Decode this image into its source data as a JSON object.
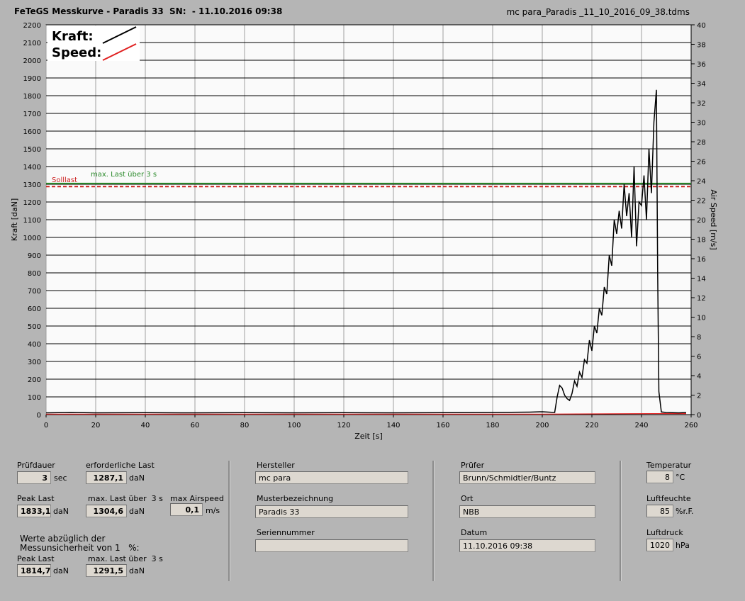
{
  "window": {
    "title": "FeTeGS Messkurve - Paradis 33  SN:  - 11.10.2016 09:38",
    "filename": "mc para_Paradis _11_10_2016_09_38.tdms"
  },
  "chart_data": {
    "type": "line",
    "xlabel": "Zeit [s]",
    "ylabel": "Kraft [daN]",
    "y2label": "Air Speed [m/s]",
    "xlim": [
      0,
      260
    ],
    "ylim": [
      0,
      2200
    ],
    "y2lim": [
      0,
      40
    ],
    "xticks": [
      0,
      20,
      40,
      60,
      80,
      100,
      120,
      140,
      160,
      180,
      200,
      220,
      240,
      260
    ],
    "yticks": [
      0,
      100,
      200,
      300,
      400,
      500,
      600,
      700,
      800,
      900,
      1000,
      1100,
      1200,
      1300,
      1400,
      1500,
      1600,
      1700,
      1800,
      1900,
      2000,
      2100,
      2200
    ],
    "y2ticks": [
      0,
      2,
      4,
      6,
      8,
      10,
      12,
      14,
      16,
      18,
      20,
      22,
      24,
      26,
      28,
      30,
      32,
      34,
      36,
      38,
      40
    ],
    "legend": [
      {
        "name": "Kraft:",
        "color": "#000000"
      },
      {
        "name": "Speed:",
        "color": "#e02020"
      }
    ],
    "reference_lines": [
      {
        "label": "Solllast",
        "value": 1287.1,
        "color": "#cc2020",
        "style": "dashed"
      },
      {
        "label": "max. Last über  3 s",
        "value": 1304.6,
        "color": "#2a8a2a",
        "style": "solid"
      }
    ],
    "series": [
      {
        "name": "Kraft",
        "color": "#000000",
        "x": [
          0,
          10,
          20,
          40,
          60,
          80,
          100,
          120,
          140,
          160,
          180,
          195,
          200,
          205,
          206,
          207,
          208,
          209,
          210,
          211,
          212,
          213,
          214,
          215,
          216,
          217,
          218,
          219,
          220,
          221,
          222,
          223,
          224,
          225,
          226,
          227,
          228,
          229,
          230,
          231,
          232,
          233,
          234,
          235,
          236,
          237,
          238,
          239,
          240,
          241,
          242,
          243,
          244,
          245,
          246,
          246.5,
          247,
          248,
          250,
          255,
          258
        ],
        "y": [
          10,
          12,
          10,
          11,
          10,
          11,
          10,
          11,
          10,
          11,
          12,
          14,
          16,
          12,
          100,
          165,
          150,
          110,
          90,
          80,
          120,
          190,
          160,
          240,
          210,
          310,
          290,
          420,
          360,
          500,
          460,
          600,
          560,
          720,
          680,
          900,
          840,
          1100,
          1020,
          1150,
          1050,
          1300,
          1120,
          1250,
          1000,
          1400,
          950,
          1200,
          1180,
          1350,
          1100,
          1500,
          1250,
          1650,
          1833,
          800,
          130,
          15,
          12,
          10,
          12
        ]
      },
      {
        "name": "Speed",
        "color": "#e02020",
        "x": [
          0,
          200,
          245,
          258
        ],
        "y": [
          0.05,
          0.05,
          0.1,
          0.1
        ]
      }
    ]
  },
  "fields": {
    "pruefdauer": {
      "label": "Prüfdauer",
      "value": "3",
      "unit": "sec"
    },
    "erforderliche_last": {
      "label": "erforderliche Last",
      "value": "1287,1",
      "unit": "daN"
    },
    "peak_last": {
      "label": "Peak Last",
      "value": "1833,1",
      "unit": "daN"
    },
    "max_last": {
      "label": "max. Last über  3 s",
      "value": "1304,6",
      "unit": "daN"
    },
    "max_airspeed": {
      "label": "max Airspeed",
      "value": "0,1",
      "unit": "m/s"
    },
    "note": "Werte abzüglich der\nMessunsicherheit von 1   %:",
    "peak_last2": {
      "label": "Peak Last",
      "value": "1814,7",
      "unit": "daN"
    },
    "max_last2": {
      "label": "max. Last über  3 s",
      "value": "1291,5",
      "unit": "daN"
    },
    "hersteller": {
      "label": "Hersteller",
      "value": "mc para"
    },
    "musterbezeichnung": {
      "label": "Musterbezeichnung",
      "value": "Paradis 33"
    },
    "seriennummer": {
      "label": "Seriennummer",
      "value": ""
    },
    "pruefer": {
      "label": "Prüfer",
      "value": "Brunn/Schmidtler/Buntz"
    },
    "ort": {
      "label": "Ort",
      "value": "NBB"
    },
    "datum": {
      "label": "Datum",
      "value": "11.10.2016 09:38"
    },
    "temperatur": {
      "label": "Temperatur",
      "value": "8",
      "unit": "°C"
    },
    "luftfeuchte": {
      "label": "Luftfeuchte",
      "value": "85",
      "unit": "%r.F."
    },
    "luftdruck": {
      "label": "Luftdruck",
      "value": "1020",
      "unit": "hPa"
    }
  }
}
